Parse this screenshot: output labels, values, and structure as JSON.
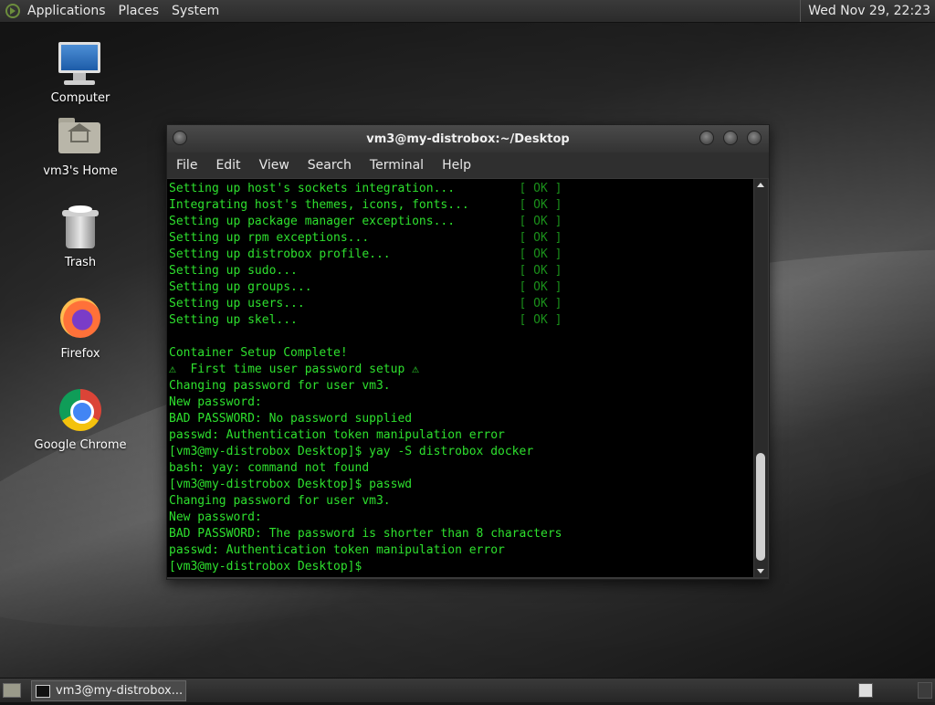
{
  "topbar": {
    "menus": [
      "Applications",
      "Places",
      "System"
    ],
    "clock": "Wed Nov 29, 22:23"
  },
  "desktop_icons": [
    {
      "label": "Computer",
      "icon": "computer-icon"
    },
    {
      "label": "vm3's Home",
      "icon": "home-folder-icon"
    },
    {
      "label": "Trash",
      "icon": "trash-icon"
    },
    {
      "label": "Firefox",
      "icon": "firefox-icon"
    },
    {
      "label": "Google Chrome",
      "icon": "chrome-icon"
    }
  ],
  "window": {
    "title": "vm3@my-distrobox:~/Desktop",
    "menus": [
      "File",
      "Edit",
      "View",
      "Search",
      "Terminal",
      "Help"
    ]
  },
  "terminal": {
    "setup_lines": [
      {
        "text": "Setting up host's sockets integration...",
        "status": "[ OK ]"
      },
      {
        "text": "Integrating host's themes, icons, fonts...",
        "status": "[ OK ]"
      },
      {
        "text": "Setting up package manager exceptions...",
        "status": "[ OK ]"
      },
      {
        "text": "Setting up rpm exceptions...",
        "status": "[ OK ]"
      },
      {
        "text": "Setting up distrobox profile...",
        "status": "[ OK ]"
      },
      {
        "text": "Setting up sudo...",
        "status": "[ OK ]"
      },
      {
        "text": "Setting up groups...",
        "status": "[ OK ]"
      },
      {
        "text": "Setting up users...",
        "status": "[ OK ]"
      },
      {
        "text": "Setting up skel...",
        "status": "[ OK ]"
      }
    ],
    "lines": [
      "",
      "Container Setup Complete!",
      "⚠  First time user password setup ⚠",
      "Changing password for user vm3.",
      "New password:",
      "BAD PASSWORD: No password supplied",
      "passwd: Authentication token manipulation error",
      "[vm3@my-distrobox Desktop]$ yay -S distrobox docker",
      "bash: yay: command not found",
      "[vm3@my-distrobox Desktop]$ passwd",
      "Changing password for user vm3.",
      "New password:",
      "BAD PASSWORD: The password is shorter than 8 characters",
      "passwd: Authentication token manipulation error",
      "[vm3@my-distrobox Desktop]$ "
    ]
  },
  "taskbar": {
    "task_label": "vm3@my-distrobox..."
  }
}
